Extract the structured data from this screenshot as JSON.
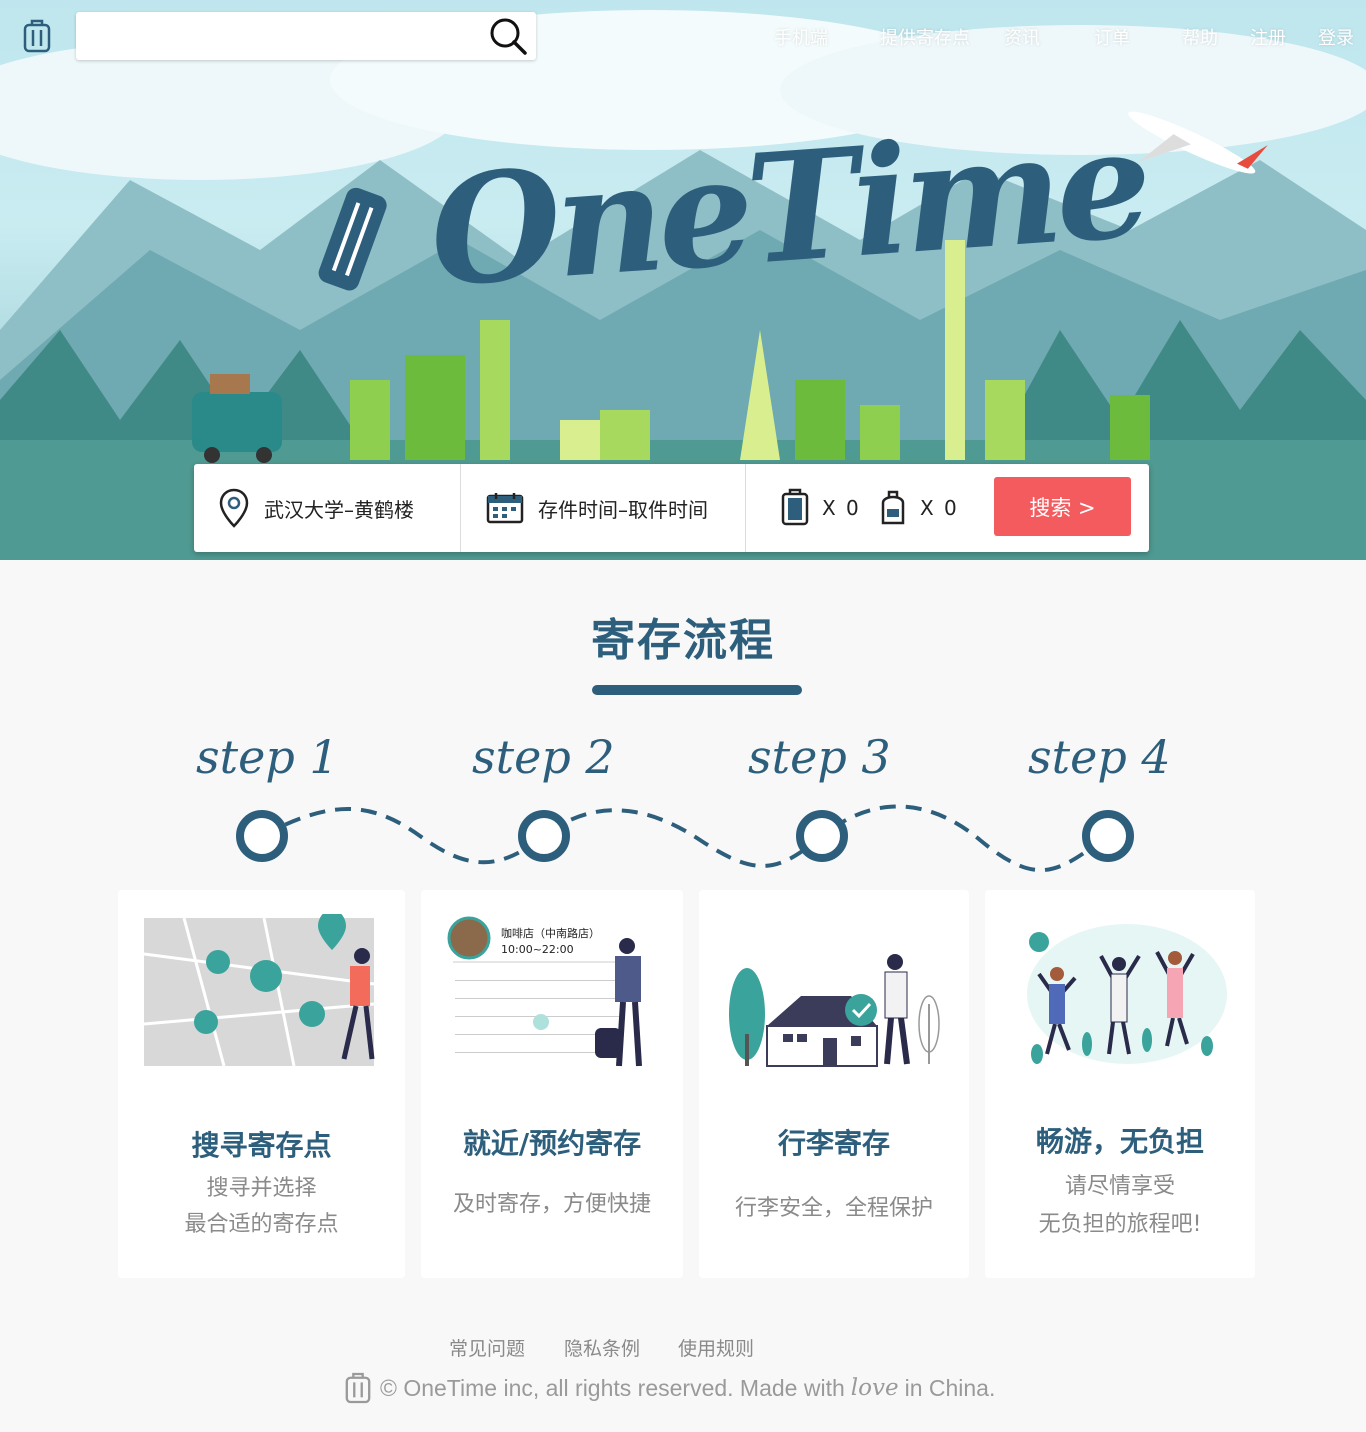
{
  "header": {
    "logo_icon": "luggage-icon",
    "search": {
      "placeholder": "",
      "icon": "search-icon"
    },
    "nav": [
      "手机端",
      "提供寄存点",
      "资讯",
      "订单",
      "帮助",
      "注册",
      "登录"
    ]
  },
  "hero": {
    "brand": "OneTime",
    "bar": {
      "location": "武汉大学–黄鹤楼",
      "time": "存件时间–取件时间",
      "suitcase_count": "X 0",
      "bag_count": "X 0",
      "search_label": "搜索 >"
    }
  },
  "process": {
    "title": "寄存流程",
    "steps": [
      {
        "label": "step 1",
        "title": "搜寻寄存点",
        "desc1": "搜寻并选择",
        "desc2": "最合适的寄存点"
      },
      {
        "label": "step 2",
        "title": "就近/预约寄存",
        "desc1": "及时寄存，方便快捷",
        "desc2": "",
        "shop_name": "咖啡店（中南路店）",
        "shop_hours": "10:00~22:00"
      },
      {
        "label": "step 3",
        "title": "行李寄存",
        "desc1": "行李安全，全程保护",
        "desc2": ""
      },
      {
        "label": "step 4",
        "title": "畅游，无负担",
        "desc1": "请尽情享受",
        "desc2": "无负担的旅程吧!"
      }
    ]
  },
  "footer": {
    "links": [
      "常见问题",
      "隐私条例",
      "使用规则"
    ],
    "copyright_pre": "© OneTime inc, all rights reserved. Made with",
    "copyright_love": "love",
    "copyright_post": "in China."
  },
  "colors": {
    "brand": "#2d5f7d",
    "accent": "#f45b5f",
    "background": "#f8f8f8"
  }
}
